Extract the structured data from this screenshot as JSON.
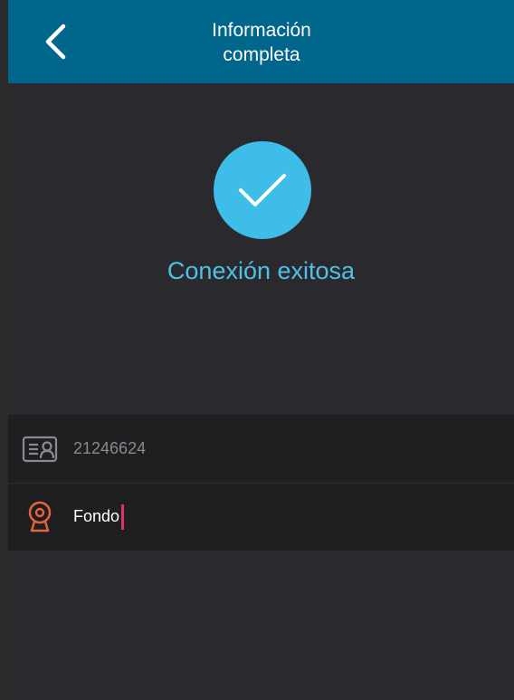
{
  "header": {
    "title": "Información\ncompleta",
    "back_icon": "chevron-left-icon"
  },
  "status": {
    "icon": "checkmark-icon",
    "text": "Conexión exitosa",
    "color": "#3dbde8"
  },
  "info": {
    "id_icon": "id-card-icon",
    "id_value": "21246624",
    "name_icon": "camera-location-icon",
    "name_value": "Fondo"
  },
  "colors": {
    "header_bg": "#00668c",
    "screen_bg": "#2a2a2e",
    "accent_orange": "#e8643c",
    "caret_pink": "#e0336b"
  }
}
